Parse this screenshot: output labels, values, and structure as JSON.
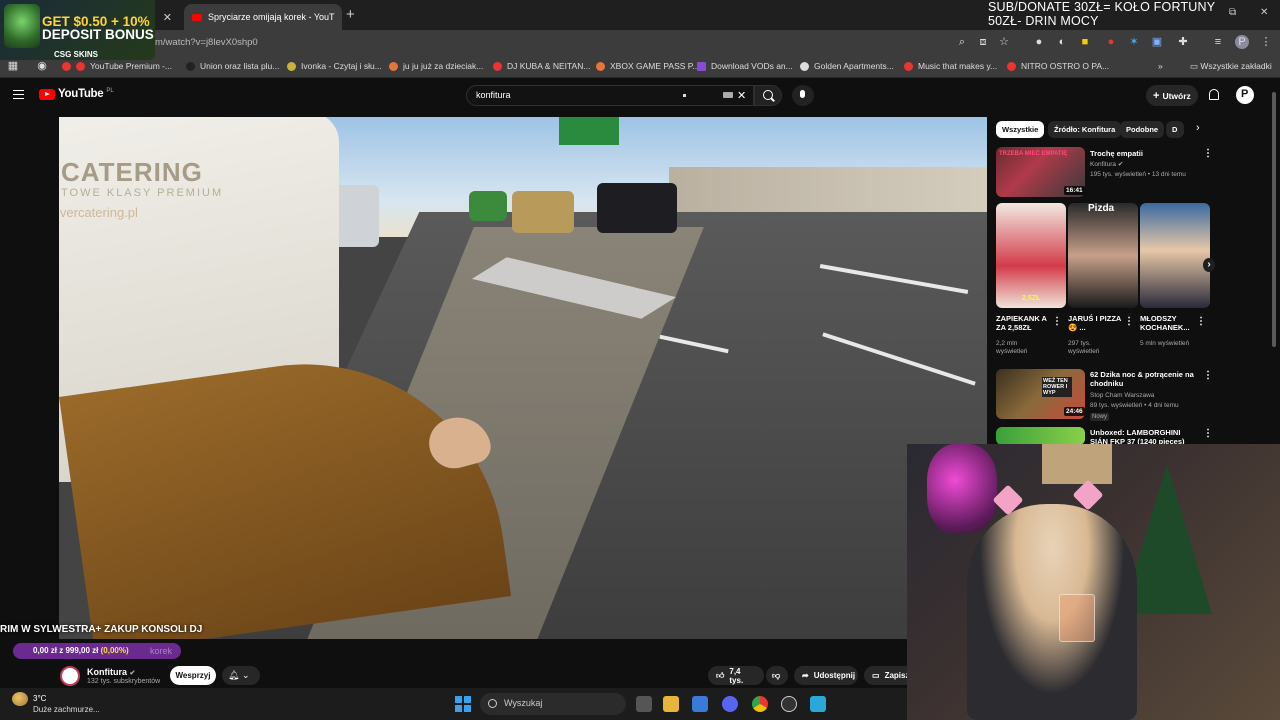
{
  "browser": {
    "tabs": [
      {
        "label": ""
      },
      {
        "label": "Spryciarze omijają korek - YouT"
      }
    ],
    "url": "m/watch?v=j8levX0shp0",
    "bookmarks": [
      "YouTube Premium -...",
      "Union oraz lista plu...",
      "Ivonka - Czytaj i słu...",
      "ju ju już za dzieciak...",
      "DJ KUBA & NEITAN...",
      "XBOX GAME PASS P...",
      "Download VODs an...",
      "Golden Apartments...",
      "Music that makes y...",
      "NITRO OSTRO O PA..."
    ],
    "all_bookmarks": "Wszystkie zakładki"
  },
  "promo": {
    "line1": "GET $0.50 + 10%",
    "line2": "DEPOSIT BONUS",
    "brand": "CSG SKINS"
  },
  "donate_overlay": {
    "line1": "SUB/DONATE 30ZŁ= KOŁO FORTUNY",
    "line2": "50ZŁ- DRIN MOCY"
  },
  "youtube": {
    "logo": "YouTube",
    "logo_country": "PL",
    "search_value": "konfitura",
    "create_label": "Utwórz",
    "avatar_letter": "P"
  },
  "video": {
    "van_text": "CATERING",
    "van_sub": "TOWE KLASY PREMIUM",
    "van_url": "lvercatering.pl"
  },
  "stream": {
    "caption": "RIM W SYLWESTRA+ ZAKUP KONSOLI DJ",
    "goal_text": "0,00 zł z 999,00 zł ",
    "goal_pct": "(0,00%)",
    "goal_fraction": 0.0,
    "goal_ghost": "korek"
  },
  "channel": {
    "name": "Konfitura",
    "subs": "132 tys. subskrybentów",
    "support": "Wesprzyj",
    "likes": "7,4 tys.",
    "share": "Udostępnij",
    "save": "Zapisz"
  },
  "sidebar": {
    "chips": [
      "Wszystkie",
      "Źródło: Konfitura",
      "Podobne",
      "D"
    ],
    "items": [
      {
        "title": "Trochę empatii",
        "channel": "Konfitura",
        "meta": "195 tys. wyświetleń • 13 dni temu",
        "duration": "16:41"
      },
      {
        "title": "62 Dzika noc & potrącenie na chodniku",
        "channel": "Stop Cham Warszawa",
        "meta": "89 tys. wyświetleń • 4 dni temu",
        "duration": "24:46",
        "badge": "Nowy"
      },
      {
        "title": "Unboxed: LAMBORGHINI SIÁN FKP 37 (1240 pieces) Mould",
        "channel": "",
        "meta": "",
        "duration": ""
      }
    ],
    "shorts": [
      {
        "title": "ZAPIEKANK A ZA 2,58ZŁ",
        "views": "2,2 mln wyświetleń",
        "thumb_label": "2,5ZŁ"
      },
      {
        "title": "JARUŚ I PIZZA 😍 ...",
        "views": "297 tys. wyświetleń",
        "thumb_label": "Pizda"
      },
      {
        "title": "MŁODSZY KOCHANEK...",
        "views": "5 mln wyświetleń",
        "thumb_label": ""
      }
    ],
    "thumb1_label": "TRZEBA MIEĆ EMPATIĘ",
    "thumb2_label": "WEŹ TEN ROWER I WYP"
  },
  "taskbar": {
    "temp": "3°C",
    "weather": "Duże zachmurze...",
    "search": "Wyszukaj"
  },
  "colors": {
    "yt_red": "#ff0000",
    "goal_bar": "#6b2a8f",
    "goal_pct": "#ffe14d"
  }
}
